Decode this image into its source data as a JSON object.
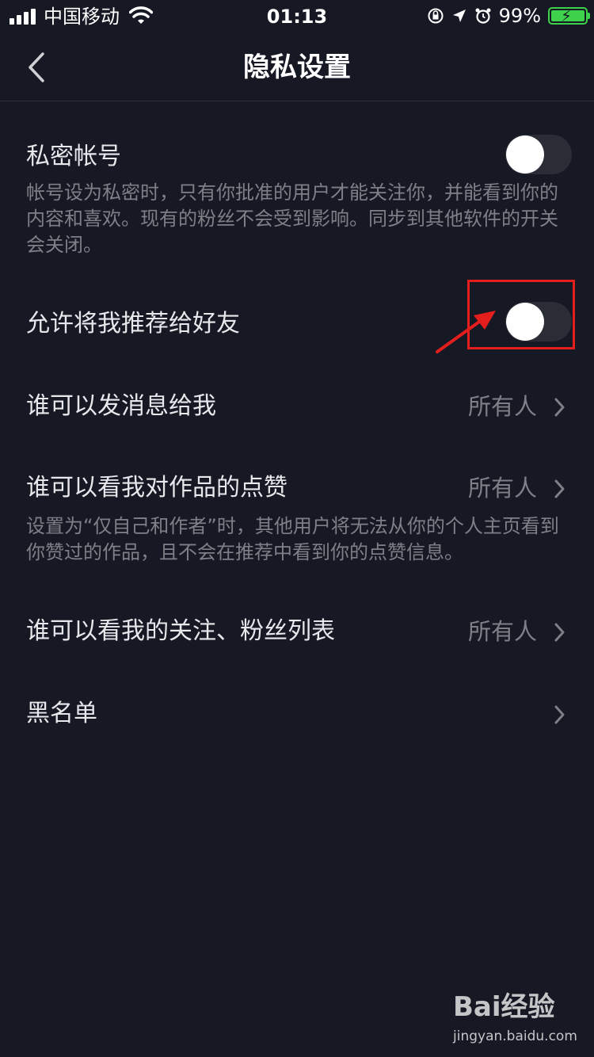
{
  "status_bar": {
    "carrier": "中国移动",
    "time": "01:13",
    "battery_percent": "99%",
    "battery_level": 0.99,
    "icons": [
      "signal-icon",
      "wifi-icon",
      "orientation-lock-icon",
      "location-icon",
      "alarm-icon",
      "battery-charging-icon"
    ]
  },
  "nav": {
    "title": "隐私设置",
    "back_icon": "chevron-left-icon"
  },
  "settings": {
    "private_account": {
      "label": "私密帐号",
      "description": "帐号设为私密时，只有你批准的用户才能关注你，并能看到你的内容和喜欢。现有的粉丝不会受到影响。同步到其他软件的开关会关闭。",
      "enabled": false
    },
    "recommend_to_friends": {
      "label": "允许将我推荐给好友",
      "enabled": false
    },
    "who_can_message": {
      "label": "谁可以发消息给我",
      "value": "所有人"
    },
    "who_can_see_likes": {
      "label": "谁可以看我对作品的点赞",
      "value": "所有人",
      "description": "设置为“仅自己和作者”时，其他用户将无法从你的个人主页看到你赞过的作品，且不会在推荐中看到你的点赞信息。"
    },
    "who_can_see_following": {
      "label": "谁可以看我的关注、粉丝列表",
      "value": "所有人"
    },
    "blacklist": {
      "label": "黑名单"
    }
  },
  "annotation": {
    "highlight_color": "#e41d1d"
  },
  "watermark": {
    "logo_text": "Bai经验",
    "url": "jingyan.baidu.com"
  },
  "colors": {
    "background": "#161823",
    "toggle_track": "#2b2d36",
    "secondary_text": "#7f8087"
  }
}
